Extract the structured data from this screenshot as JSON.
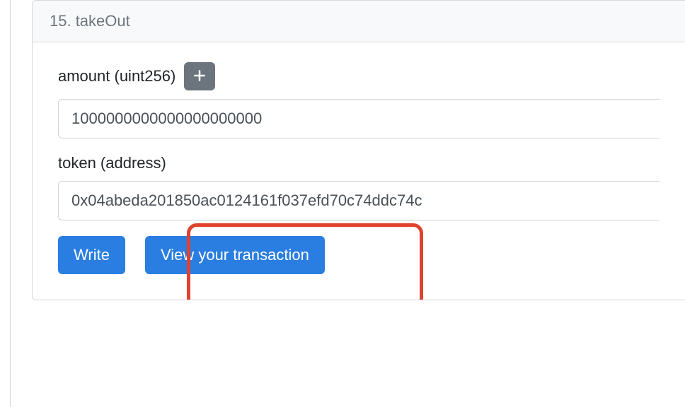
{
  "panel": {
    "header": "15. takeOut",
    "fields": {
      "amount": {
        "label": "amount (uint256)",
        "value": "1000000000000000000000"
      },
      "token": {
        "label": "token (address)",
        "value": "0x04abeda201850ac0124161f037efd70c74ddc74c"
      }
    },
    "buttons": {
      "write": "Write",
      "view_tx": "View your transaction"
    }
  }
}
